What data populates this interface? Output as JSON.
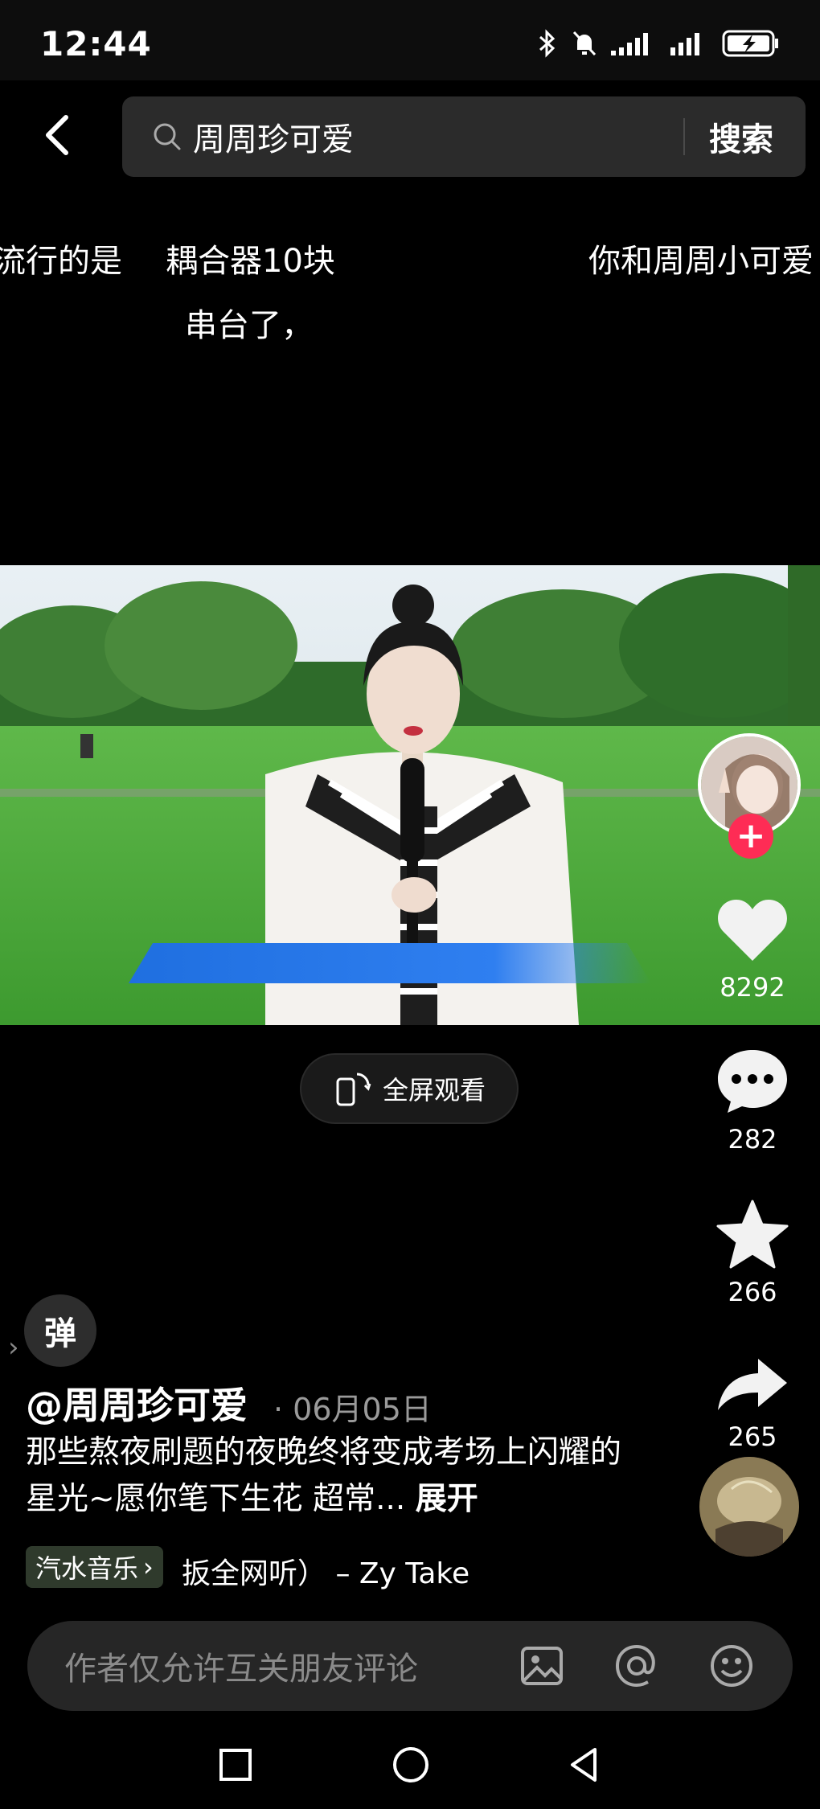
{
  "status_bar": {
    "time": "12:44",
    "battery_icon": "battery-charging-icon"
  },
  "search": {
    "query": "周周珍可爱",
    "button_label": "搜索"
  },
  "danmaku": [
    "流行的是",
    "耦合器10块",
    "你和周周小可爱",
    "串台了，"
  ],
  "video": {
    "scene": "outdoor park interview"
  },
  "rail": {
    "likes": "8292",
    "comments": "282",
    "favorites": "266",
    "shares": "265"
  },
  "fullscreen": {
    "label": "全屏观看"
  },
  "danmaku_toggle": {
    "label": "弹"
  },
  "post": {
    "author": "@周周珍可爱",
    "date": "· 06月05日",
    "description": "那些熬夜刷题的夜晚终将变成考场上闪耀的星光~愿你笔下生花 超常...",
    "expand_label": "展开"
  },
  "music": {
    "tag_label": "汽水音乐",
    "track": "扳全网听） – Zy    Take"
  },
  "comment_bar": {
    "placeholder": "作者仅允许互关朋友评论"
  },
  "colors": {
    "accent_red": "#fe2c55",
    "background": "#000000",
    "search_bg": "#2b2b2b"
  }
}
